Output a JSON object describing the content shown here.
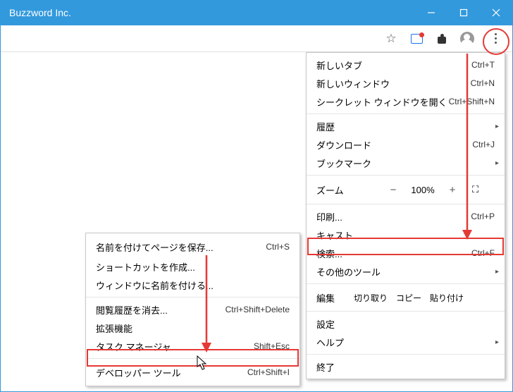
{
  "window": {
    "title": "Buzzword Inc."
  },
  "toolbar": {
    "star": "☆"
  },
  "main_menu": {
    "new_tab": {
      "label": "新しいタブ",
      "accel": "Ctrl+T"
    },
    "new_window": {
      "label": "新しいウィンドウ",
      "accel": "Ctrl+N"
    },
    "new_incognito": {
      "label": "シークレット ウィンドウを開く",
      "accel": "Ctrl+Shift+N"
    },
    "history": {
      "label": "履歴"
    },
    "downloads": {
      "label": "ダウンロード",
      "accel": "Ctrl+J"
    },
    "bookmarks": {
      "label": "ブックマーク"
    },
    "zoom": {
      "label": "ズーム",
      "minus": "−",
      "value": "100%",
      "plus": "+",
      "fullscreen": "⸬"
    },
    "print": {
      "label": "印刷...",
      "accel": "Ctrl+P"
    },
    "cast": {
      "label": "キャスト..."
    },
    "find": {
      "label": "検索...",
      "accel": "Ctrl+F"
    },
    "more_tools": {
      "label": "その他のツール"
    },
    "edit": {
      "label": "編集",
      "cut": "切り取り",
      "copy": "コピー",
      "paste": "貼り付け"
    },
    "settings": {
      "label": "設定"
    },
    "help": {
      "label": "ヘルプ"
    },
    "exit": {
      "label": "終了"
    }
  },
  "sub_menu": {
    "save_as": {
      "label": "名前を付けてページを保存...",
      "accel": "Ctrl+S"
    },
    "shortcut": {
      "label": "ショートカットを作成..."
    },
    "name_window": {
      "label": "ウィンドウに名前を付ける..."
    },
    "clear_data": {
      "label": "閲覧履歴を消去...",
      "accel": "Ctrl+Shift+Delete"
    },
    "extensions": {
      "label": "拡張機能"
    },
    "task_mgr": {
      "label": "タスク マネージャ",
      "accel": "Shift+Esc"
    },
    "devtools": {
      "label": "デベロッパー ツール",
      "accel": "Ctrl+Shift+I"
    }
  },
  "glyphs": {
    "arrow_right": "▸",
    "fullscreen": "⛶"
  }
}
